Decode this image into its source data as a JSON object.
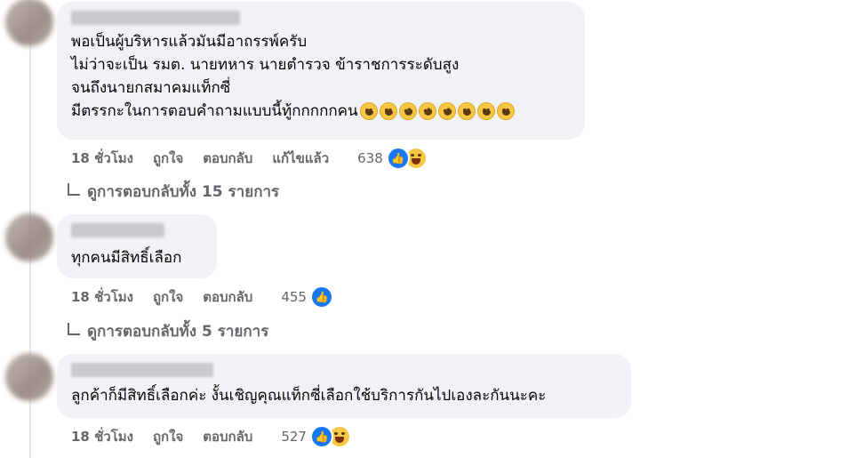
{
  "comments": [
    {
      "text": "พอเป็นผู้บริหารแล้วมันมีอาถรรพ์ครับ\nไม่ว่าจะเป็น รมต. นายทหาร นายตำรวจ ข้าราชการระดับสูง\nจนถึงนายกสมาคมแท็กซี่\nมีตรรกะในการตอบคำถามแบบนี้ทู้กกกกกคน",
      "emojis": [
        "grin-icon",
        "grin-icon",
        "rofl-icon",
        "rofl-icon",
        "rofl-icon",
        "laugh-icon",
        "laugh-icon",
        "laugh-icon"
      ],
      "time": "18 ชั่วโมง",
      "like": "ถูกใจ",
      "reply": "ตอบกลับ",
      "edited": "แก้ไขแล้ว",
      "reaction_count": "638",
      "reactions": [
        "like-icon",
        "haha-icon"
      ]
    },
    {
      "text": "ทุกคนมีสิทธิ์เลือก",
      "time": "18 ชั่วโมง",
      "like": "ถูกใจ",
      "reply": "ตอบกลับ",
      "reaction_count": "455",
      "reactions": [
        "like-icon"
      ]
    },
    {
      "text": "ลูกค้าก็มีสิทธิ์เลือกค่ะ งั้นเชิญคุณแท็กซี่เลือกใช้บริการกันไปเองละกันนะคะ",
      "time": "18 ชั่วโมง",
      "like": "ถูกใจ",
      "reply": "ตอบกลับ",
      "reaction_count": "527",
      "reactions": [
        "like-icon",
        "haha-icon"
      ]
    }
  ],
  "view_replies": [
    "ดูการตอบกลับทั้ง 15 รายการ",
    "ดูการตอบกลับทั้ง 5 รายการ"
  ],
  "colors": {
    "bubble": "#f0f2f5",
    "meta": "#65676b",
    "like_blue": "#1877f2"
  }
}
